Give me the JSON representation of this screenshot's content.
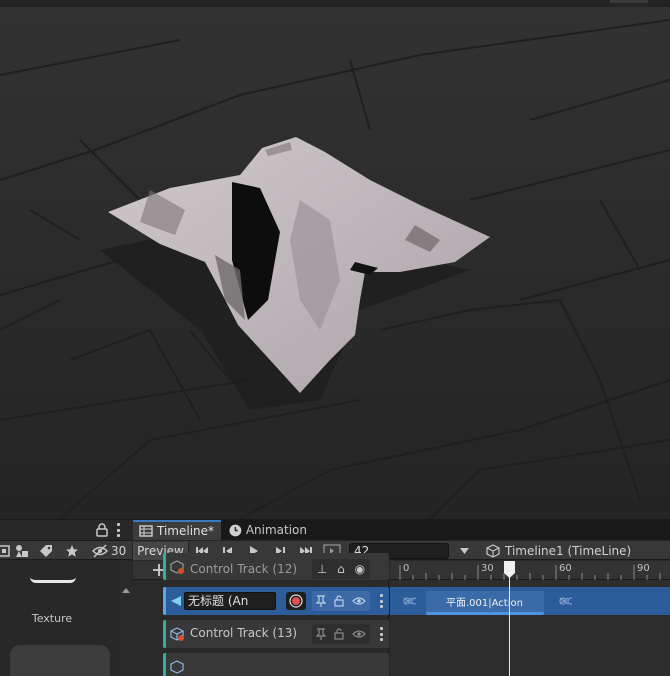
{
  "left_panel": {
    "hidden_count": "30",
    "asset_label": "Texture"
  },
  "timeline": {
    "tabs": [
      {
        "label": "Timeline*",
        "icon": "timeline-icon",
        "active": true
      },
      {
        "label": "Animation",
        "icon": "animation-clock-icon",
        "active": false
      }
    ],
    "toolbar": {
      "preview_label": "Preview",
      "frame_value": "42",
      "asset_name": "Timeline1 (TimeLine)"
    },
    "ruler": {
      "labels": [
        "0",
        "30",
        "60",
        "90"
      ],
      "playhead_frame": 42
    },
    "tracks": [
      {
        "name": "Control Track (12)",
        "type": "control"
      },
      {
        "name": "无标题 (An",
        "type": "animation",
        "selected": true
      },
      {
        "name": "Control Track (13)",
        "type": "control"
      }
    ],
    "clip": {
      "label": "平面.001|Action"
    }
  },
  "colors": {
    "accent": "#3a79bb",
    "track_selected": "#2c5d9a",
    "control_track": "#2fb0a0",
    "record": "#e05050"
  }
}
